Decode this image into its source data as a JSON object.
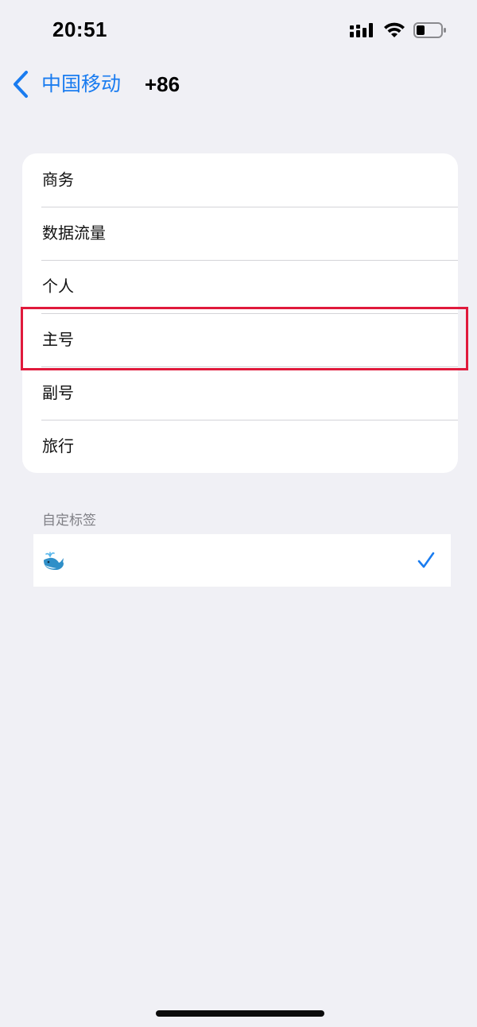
{
  "status_bar": {
    "time": "20:51",
    "icons": [
      "signal-icon",
      "wifi-icon",
      "battery-icon"
    ]
  },
  "nav": {
    "back_label": "中国移动",
    "phone": "+86"
  },
  "options": [
    {
      "label": "商务"
    },
    {
      "label": "数据流量"
    },
    {
      "label": "个人"
    },
    {
      "label": "主号"
    },
    {
      "label": "副号"
    },
    {
      "label": "旅行"
    }
  ],
  "custom_section": {
    "header": "自定标签",
    "item_icon": "whale-icon",
    "selected": true
  },
  "colors": {
    "accent": "#1a7cf0",
    "highlight": "#e01a3c",
    "background": "#f0f0f5"
  }
}
